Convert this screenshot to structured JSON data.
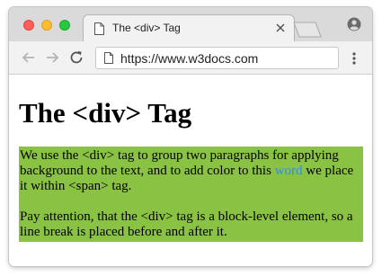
{
  "browser": {
    "tab_title": "The <div> Tag",
    "url": "https://www.w3docs.com",
    "icons": {
      "tab_page": "page-icon",
      "close": "close-icon",
      "new_tab": "new-tab-icon",
      "profile": "profile-icon",
      "back": "back-arrow-icon",
      "forward": "forward-arrow-icon",
      "reload": "reload-icon",
      "url_page": "page-icon",
      "menu": "more-vertical-icon"
    }
  },
  "page": {
    "heading": "The <div> Tag",
    "paragraph1": {
      "before": "We use the <div> tag to group two paragraphs for applying background to the text, and to add color to this ",
      "highlight": "word",
      "after": " we place it within <span> tag."
    },
    "paragraph2": "Pay attention, that the <div> tag is a block-level element, so a line break is placed before and after it."
  },
  "colors": {
    "div_background": "#8ac343",
    "span_text": "#2e90d7"
  }
}
